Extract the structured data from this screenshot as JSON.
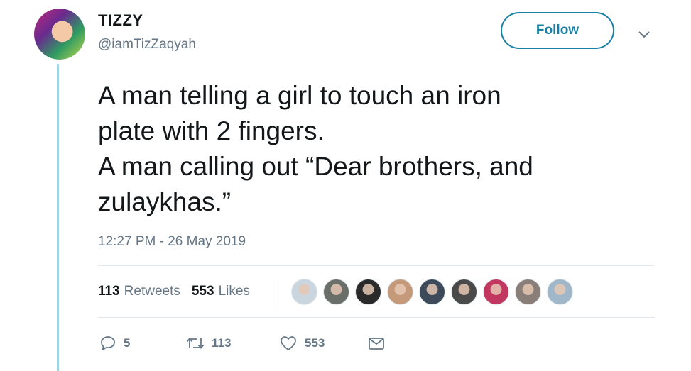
{
  "user": {
    "display_name": "TIZZY",
    "handle": "@iamTizZaqyah",
    "follow_label": "Follow"
  },
  "tweet": {
    "lines": [
      "A man telling a girl to touch an iron",
      "plate with 2 fingers.",
      "A man calling out “Dear brothers, and",
      "zulaykhas.”"
    ],
    "timestamp": "12:27 PM - 26 May 2019"
  },
  "stats": {
    "retweets_count": "113",
    "retweets_label": "Retweets",
    "likes_count": "553",
    "likes_label": "Likes"
  },
  "likers": [
    {
      "color": "#c9d6df"
    },
    {
      "color": "#6b6f6a"
    },
    {
      "color": "#2a2a2a"
    },
    {
      "color": "#c49a7a"
    },
    {
      "color": "#3c4a5a"
    },
    {
      "color": "#4a4a4a"
    },
    {
      "color": "#c2375f"
    },
    {
      "color": "#8a7f78"
    },
    {
      "color": "#9fb7c9"
    }
  ],
  "actions": {
    "reply_count": "5",
    "retweet_count": "113",
    "like_count": "553"
  },
  "colors": {
    "accent": "#1a7fa4",
    "secondary_text": "#657786",
    "thread_line": "#9fd6e3"
  }
}
